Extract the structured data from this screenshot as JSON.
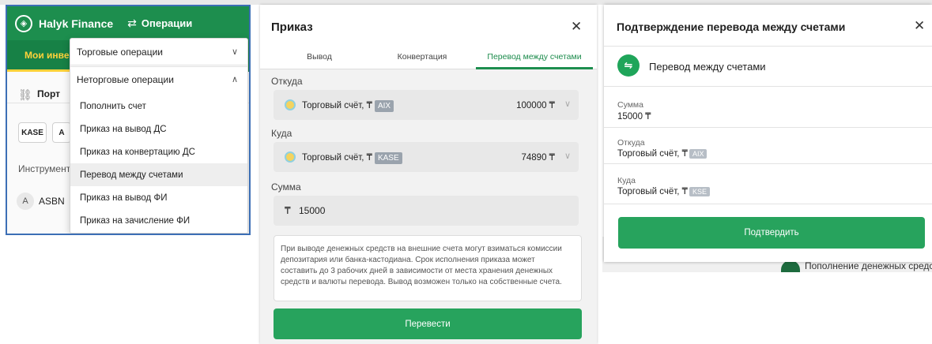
{
  "app": {
    "brand": "Halyk Finance",
    "logo_icon": "halyk-logo-icon",
    "operations_label": "Операции"
  },
  "sidebar": {
    "my_tab": "Мои инве",
    "portfolio_label": "Порт",
    "chips": [
      "KASE",
      "A"
    ],
    "instruments_label": "Инструмент",
    "instrument_avatar": "A",
    "instrument_name": "ASBN"
  },
  "dropdown": {
    "trade_ops": "Торговые операции",
    "nontrade_ops": "Неторговые операции",
    "items": [
      "Пополнить счет",
      "Приказ на вывод ДС",
      "Приказ на конвертацию ДС",
      "Перевод между счетами",
      "Приказ на вывод ФИ",
      "Приказ на зачисление ФИ"
    ],
    "selected_index": 3
  },
  "order_dialog": {
    "title": "Приказ",
    "tabs": [
      "Вывод",
      "Конвертация",
      "Перевод между счетами"
    ],
    "active_tab": 2,
    "from_label": "Откуда",
    "from_account": "Торговый счёт, ₸",
    "from_tag": "AIX",
    "from_amount": "100000 ₸",
    "to_label": "Куда",
    "to_account": "Торговый счёт, ₸",
    "to_tag": "KASE",
    "to_amount": "74890 ₸",
    "sum_label": "Сумма",
    "currency_symbol": "₸",
    "sum_value": "15000",
    "notice_lines": [
      "При выводе денежных средств на внешние счета могут взиматься комиссии",
      "депозитария или банка-кастодиана. Срок исполнения приказа может",
      "составить до 3 рабочих дней в зависимости от места хранения денежных",
      "средств и валюты перевода. Вывод возможен только на собственные счета."
    ],
    "submit_label": "Перевести"
  },
  "confirm_dialog": {
    "title": "Подтверждение перевода между счетами",
    "subtitle": "Перевод между счетами",
    "sum_label": "Сумма",
    "sum_value": "15000 ₸",
    "from_label": "Откуда",
    "from_value": "Торговый счёт, ₸",
    "from_tag": "AIX",
    "to_label": "Куда",
    "to_value": "Торговый счёт, ₸",
    "to_tag": "KSE",
    "confirm_label": "Подтвердить",
    "background_text": "Пополнение денежных средс"
  },
  "colors": {
    "brand_green": "#1d8e4e",
    "button_green": "#27a35d",
    "accent_yellow": "#ffd23a"
  }
}
